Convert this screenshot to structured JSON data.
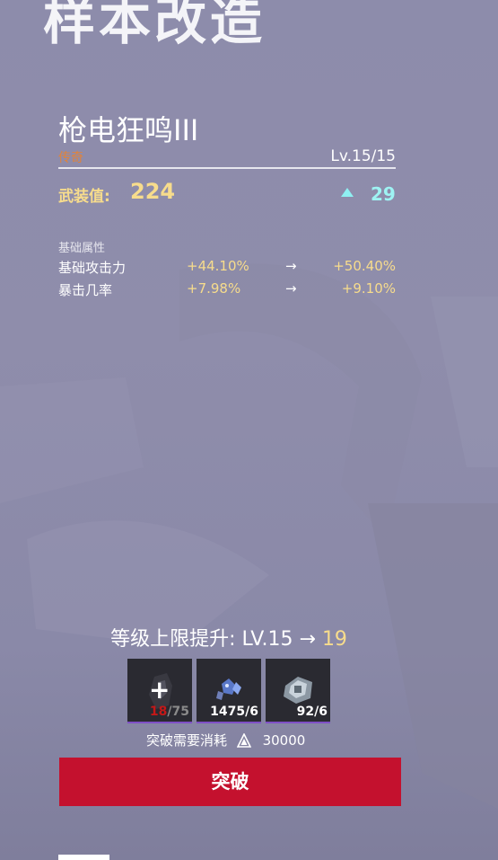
{
  "page": {
    "title": "样本改造"
  },
  "weapon": {
    "name": "枪电狂鸣III",
    "rarity": "传奇",
    "level": "Lv.15/15"
  },
  "armor": {
    "label": "武装值:",
    "value": "224",
    "increase": "29"
  },
  "attributes": {
    "header": "基础属性",
    "rows": [
      {
        "name": "基础攻击力",
        "from": "+44.10%",
        "arrow": "→",
        "to": "+50.40%"
      },
      {
        "name": "暴击几率",
        "from": "+7.98%",
        "arrow": "→",
        "to": "+9.10%"
      }
    ]
  },
  "level_cap": {
    "text": "等级上限提升: LV.15 → ",
    "to": "19"
  },
  "materials": [
    {
      "icon": "weapon-sample-icon",
      "have": "18",
      "need": "/75",
      "add_symbol": "+"
    },
    {
      "icon": "crystal-material-icon",
      "count": "1475/6"
    },
    {
      "icon": "mech-part-icon",
      "count": "92/6"
    }
  ],
  "cost": {
    "label": "突破需要消耗",
    "currency_icon": "triangle-coin-icon",
    "amount": "30000"
  },
  "action": {
    "label": "突破"
  },
  "colors": {
    "accent_gold": "#f7dc8c",
    "accent_cyan": "#9ef3f3",
    "rarity_orange": "#e0833b",
    "button_red": "#c4112e",
    "shortage_red": "#c41818"
  }
}
